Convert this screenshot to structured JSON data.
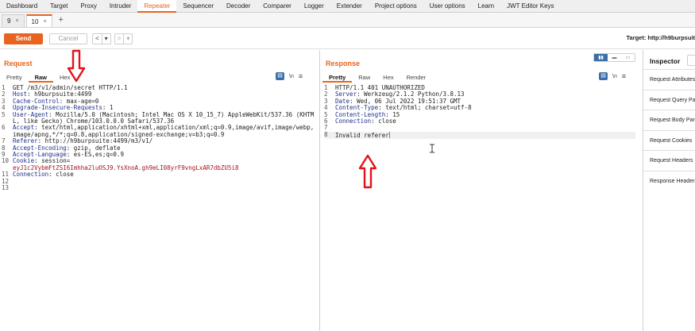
{
  "top_tabs": [
    "Dashboard",
    "Target",
    "Proxy",
    "Intruder",
    "Repeater",
    "Sequencer",
    "Decoder",
    "Comparer",
    "Logger",
    "Extender",
    "Project options",
    "User options",
    "Learn",
    "JWT Editor Keys"
  ],
  "active_top_tab": "Repeater",
  "sub_tabs": [
    {
      "label": "9",
      "close": "×"
    },
    {
      "label": "10",
      "close": "×"
    }
  ],
  "add_tab": "+",
  "toolbar": {
    "send": "Send",
    "cancel": "Cancel",
    "back": "<",
    "back_menu": "▾",
    "forward": ">",
    "forward_menu": "▾",
    "target": "Target: http://h9burpsuit"
  },
  "request": {
    "title": "Request",
    "tabs": [
      "Pretty",
      "Raw",
      "Hex"
    ],
    "active_tab": "Raw",
    "newline_toggle": "\\n",
    "menu": "≡",
    "lines": [
      {
        "n": "1",
        "text": "GET /m3/v1/admin/secret HTTP/1.1"
      },
      {
        "n": "2",
        "key": "Host",
        "value": " h9burpsuite:4499"
      },
      {
        "n": "3",
        "key": "Cache-Control",
        "value": " max-age=0"
      },
      {
        "n": "4",
        "key": "Upgrade-Insecure-Requests",
        "value": " 1"
      },
      {
        "n": "5",
        "key": "User-Agent",
        "value": " Mozilla/5.0 (Macintosh; Intel Mac OS X 10_15_7) AppleWebKit/537.36 (KHTML, like Gecko) Chrome/103.0.0.0 Safari/537.36"
      },
      {
        "n": "6",
        "key": "Accept",
        "value": " text/html,application/xhtml+xml,application/xml;q=0.9,image/avif,image/webp,image/apng,*/*;q=0.8,application/signed-exchange;v=b3;q=0.9"
      },
      {
        "n": "7",
        "key": "Referer",
        "value": " http://h9burpsuite:4499/m3/v1/"
      },
      {
        "n": "8",
        "key": "Accept-Encoding",
        "value": " gzip, deflate"
      },
      {
        "n": "9",
        "key": "Accept-Language",
        "value": " es-ES,es;q=0.9"
      },
      {
        "n": "10",
        "key": "Cookie",
        "value": " session=",
        "cookie": "eyJ1c2VybmFtZSI6Imhha2luOSJ9.YsXnoA.gh9eLI08yrF9vngLxAR7dbZU5i8"
      },
      {
        "n": "11",
        "key": "Connection",
        "value": " close"
      },
      {
        "n": "12",
        "text": ""
      },
      {
        "n": "13",
        "text": ""
      }
    ]
  },
  "response": {
    "title": "Response",
    "tabs": [
      "Pretty",
      "Raw",
      "Hex",
      "Render"
    ],
    "active_tab": "Pretty",
    "newline_toggle": "\\n",
    "menu": "≡",
    "lines": [
      {
        "n": "1",
        "text": "HTTP/1.1 401 UNAUTHORIZED"
      },
      {
        "n": "2",
        "key": "Server",
        "value": " Werkzeug/2.1.2 Python/3.8.13"
      },
      {
        "n": "3",
        "key": "Date",
        "value": " Wed, 06 Jul 2022 19:51:37 GMT"
      },
      {
        "n": "4",
        "key": "Content-Type",
        "value": " text/html; charset=utf-8"
      },
      {
        "n": "5",
        "key": "Content-Length",
        "value": " 15"
      },
      {
        "n": "6",
        "key": "Connection",
        "value": " close"
      },
      {
        "n": "7",
        "text": ""
      },
      {
        "n": "8",
        "text": "Invalid referer"
      }
    ]
  },
  "inspector": {
    "title": "Inspector",
    "items": [
      "Request Attributes",
      "Request Query Parameters",
      "Request Body Parameters",
      "Request Cookies",
      "Request Headers",
      "Response Headers"
    ]
  },
  "colors": {
    "accent": "#e8641e",
    "annotation_arrow": "#e0141c",
    "header_key": "#1e2f8a",
    "cookie_value": "#a4141a"
  },
  "icons": {
    "arrow_annotation": "down-arrow-icon / up-arrow-icon",
    "text_cursor": "i-beam-cursor-icon"
  }
}
